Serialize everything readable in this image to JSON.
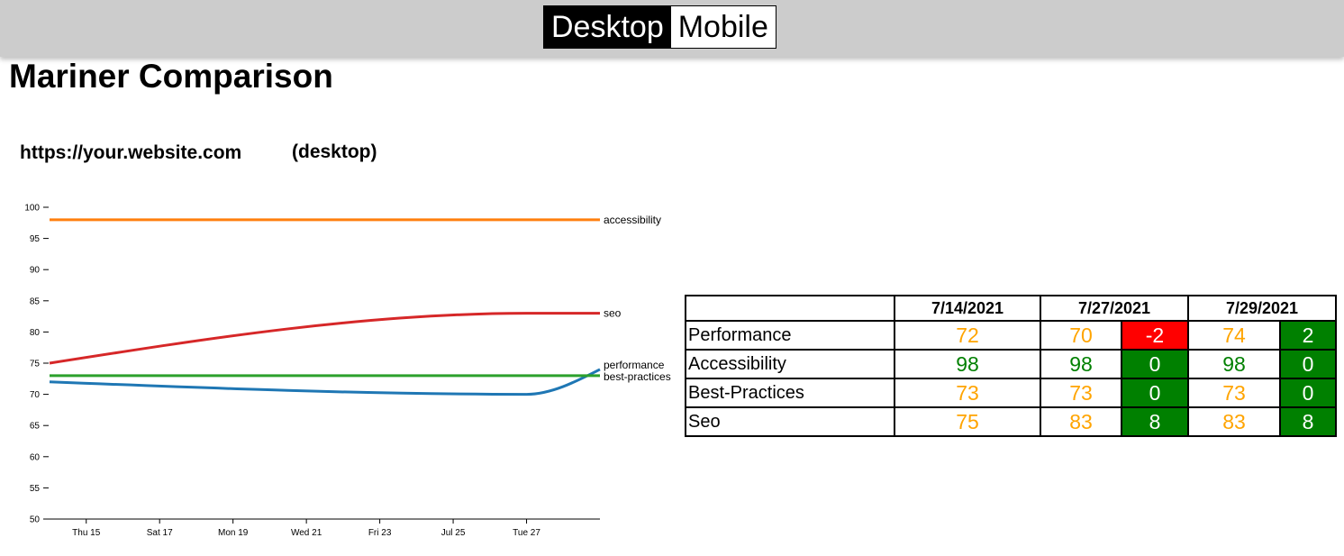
{
  "toggle": {
    "desktop_label": "Desktop",
    "mobile_label": "Mobile"
  },
  "page": {
    "title": "Mariner Comparison",
    "site_url": "https://your.website.com",
    "device": "(desktop)"
  },
  "chart_data": {
    "type": "line",
    "title": "",
    "xlabel": "",
    "ylabel": "",
    "ylim": [
      50,
      100
    ],
    "yticks": [
      50,
      55,
      60,
      65,
      70,
      75,
      80,
      85,
      90,
      95,
      100
    ],
    "xlim": [
      "2021-07-14",
      "2021-07-29"
    ],
    "xticks": [
      {
        "date": "2021-07-15",
        "label": "Thu 15"
      },
      {
        "date": "2021-07-17",
        "label": "Sat 17"
      },
      {
        "date": "2021-07-19",
        "label": "Mon 19"
      },
      {
        "date": "2021-07-21",
        "label": "Wed 21"
      },
      {
        "date": "2021-07-23",
        "label": "Fri 23"
      },
      {
        "date": "2021-07-25",
        "label": "Jul 25"
      },
      {
        "date": "2021-07-27",
        "label": "Tue 27"
      }
    ],
    "grid": false,
    "legend": "inline labels at line ends",
    "series": [
      {
        "name": "accessibility",
        "color": "#ff7f0e",
        "points": [
          [
            "2021-07-14",
            98
          ],
          [
            "2021-07-27",
            98
          ],
          [
            "2021-07-29",
            98
          ]
        ]
      },
      {
        "name": "seo",
        "color": "#d62728",
        "points": [
          [
            "2021-07-14",
            75
          ],
          [
            "2021-07-27",
            83
          ],
          [
            "2021-07-29",
            83
          ]
        ]
      },
      {
        "name": "performance",
        "color": "#1f77b4",
        "points": [
          [
            "2021-07-14",
            72
          ],
          [
            "2021-07-27",
            70
          ],
          [
            "2021-07-29",
            74
          ]
        ]
      },
      {
        "name": "best-practices",
        "color": "#2ca02c",
        "points": [
          [
            "2021-07-14",
            73
          ],
          [
            "2021-07-27",
            73
          ],
          [
            "2021-07-29",
            73
          ]
        ]
      }
    ]
  },
  "table": {
    "dates": [
      "7/14/2021",
      "7/27/2021",
      "7/29/2021"
    ],
    "rows": [
      {
        "label": "Performance",
        "cells": [
          {
            "value": "72",
            "color": "orange"
          },
          {
            "value": "70",
            "color": "orange"
          },
          {
            "delta": "-2",
            "bg": "red"
          },
          {
            "value": "74",
            "color": "orange"
          },
          {
            "delta": "2",
            "bg": "green"
          }
        ]
      },
      {
        "label": "Accessibility",
        "cells": [
          {
            "value": "98",
            "color": "green"
          },
          {
            "value": "98",
            "color": "green"
          },
          {
            "delta": "0",
            "bg": "green"
          },
          {
            "value": "98",
            "color": "green"
          },
          {
            "delta": "0",
            "bg": "green"
          }
        ]
      },
      {
        "label": "Best-Practices",
        "cells": [
          {
            "value": "73",
            "color": "orange"
          },
          {
            "value": "73",
            "color": "orange"
          },
          {
            "delta": "0",
            "bg": "green"
          },
          {
            "value": "73",
            "color": "orange"
          },
          {
            "delta": "0",
            "bg": "green"
          }
        ]
      },
      {
        "label": "Seo",
        "cells": [
          {
            "value": "75",
            "color": "orange"
          },
          {
            "value": "83",
            "color": "orange"
          },
          {
            "delta": "8",
            "bg": "green"
          },
          {
            "value": "83",
            "color": "orange"
          },
          {
            "delta": "8",
            "bg": "green"
          }
        ]
      }
    ]
  },
  "colors": {
    "orange_score": "#ffa400",
    "green_score": "#008000",
    "delta_positive_bg": "#008000",
    "delta_negative_bg": "#ff0000",
    "topbar_bg": "#cccccc"
  }
}
